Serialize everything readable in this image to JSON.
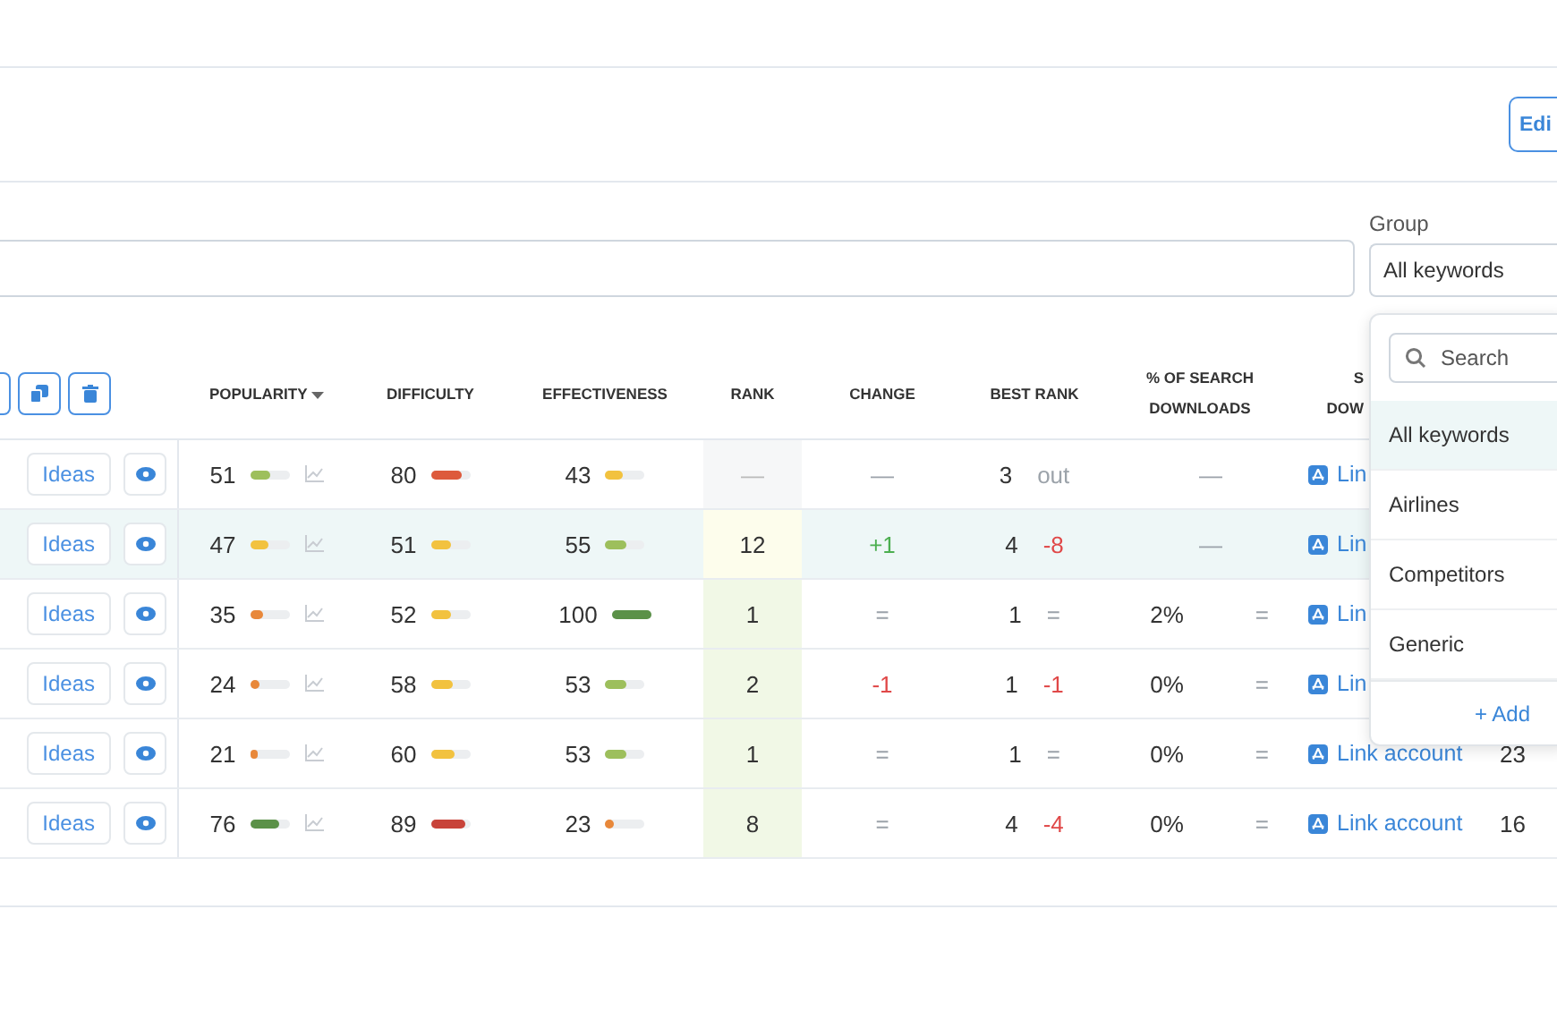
{
  "toolbar": {
    "edit_button": "Edi"
  },
  "filter": {
    "group_label": "Group",
    "group_value": "All keywords"
  },
  "table": {
    "columns": [
      {
        "label": "POPULARITY",
        "sorted": true
      },
      {
        "label": "DIFFICULTY",
        "sorted": false
      },
      {
        "label": "EFFECTIVENESS",
        "sorted": false
      },
      {
        "label": "RANK",
        "sorted": false
      },
      {
        "label": "CHANGE",
        "sorted": false
      },
      {
        "label": "BEST RANK",
        "sorted": false
      },
      {
        "label": "% OF SEARCH DOWNLOADS",
        "sorted": false
      },
      {
        "label": "S DOW",
        "sorted": false
      }
    ],
    "rows": [
      {
        "selected": false,
        "ideas": "Ideas",
        "popularity": {
          "value": "51",
          "level": 0.51,
          "color": "#9dbf5c"
        },
        "difficulty": {
          "value": "80",
          "level": 0.8,
          "color": "#dd5a3c"
        },
        "effectiveness": {
          "value": "43",
          "level": 0.43,
          "color": "#f2c23f"
        },
        "rank": {
          "value": "—",
          "kind": "unranked"
        },
        "change": {
          "value": "—",
          "kind": "none"
        },
        "best_rank": {
          "value": "3",
          "delta": "out",
          "kind": "none"
        },
        "downloads": {
          "value": "—",
          "kind": "none"
        },
        "link": "Lin"
      },
      {
        "selected": true,
        "ideas": "Ideas",
        "popularity": {
          "value": "47",
          "level": 0.47,
          "color": "#f2c23f"
        },
        "difficulty": {
          "value": "51",
          "level": 0.51,
          "color": "#f2c23f"
        },
        "effectiveness": {
          "value": "55",
          "level": 0.55,
          "color": "#9dbf5c"
        },
        "rank": {
          "value": "12",
          "kind": "low"
        },
        "change": {
          "value": "+1",
          "kind": "up"
        },
        "best_rank": {
          "value": "4",
          "delta": "-8",
          "kind": "down"
        },
        "downloads": {
          "value": "—",
          "kind": "none"
        },
        "link": "Lin"
      },
      {
        "selected": false,
        "ideas": "Ideas",
        "popularity": {
          "value": "35",
          "level": 0.35,
          "color": "#e8883a"
        },
        "difficulty": {
          "value": "52",
          "level": 0.52,
          "color": "#f2c23f"
        },
        "effectiveness": {
          "value": "100",
          "level": 1,
          "color": "#5b9148"
        },
        "rank": {
          "value": "1",
          "kind": "top"
        },
        "change": {
          "value": "=",
          "kind": "same"
        },
        "best_rank": {
          "value": "1",
          "delta": "=",
          "kind": "same"
        },
        "downloads": {
          "value": "2%",
          "trend": "=",
          "kind": "value"
        },
        "link": "Lin"
      },
      {
        "selected": false,
        "ideas": "Ideas",
        "popularity": {
          "value": "24",
          "level": 0.24,
          "color": "#e8883a"
        },
        "difficulty": {
          "value": "58",
          "level": 0.58,
          "color": "#f2c23f"
        },
        "effectiveness": {
          "value": "53",
          "level": 0.53,
          "color": "#9dbf5c"
        },
        "rank": {
          "value": "2",
          "kind": "top"
        },
        "change": {
          "value": "-1",
          "kind": "down"
        },
        "best_rank": {
          "value": "1",
          "delta": "-1",
          "kind": "down"
        },
        "downloads": {
          "value": "0%",
          "trend": "=",
          "kind": "value"
        },
        "link": "Lin"
      },
      {
        "selected": false,
        "ideas": "Ideas",
        "popularity": {
          "value": "21",
          "level": 0.21,
          "color": "#e8883a"
        },
        "difficulty": {
          "value": "60",
          "level": 0.6,
          "color": "#f2c23f"
        },
        "effectiveness": {
          "value": "53",
          "level": 0.53,
          "color": "#9dbf5c"
        },
        "rank": {
          "value": "1",
          "kind": "top"
        },
        "change": {
          "value": "=",
          "kind": "same"
        },
        "best_rank": {
          "value": "1",
          "delta": "=",
          "kind": "same"
        },
        "downloads": {
          "value": "0%",
          "trend": "=",
          "kind": "value"
        },
        "link": "Link account",
        "column_10": "23"
      },
      {
        "selected": false,
        "ideas": "Ideas",
        "popularity": {
          "value": "76",
          "level": 0.76,
          "color": "#5b9148"
        },
        "difficulty": {
          "value": "89",
          "level": 0.89,
          "color": "#c8433a"
        },
        "effectiveness": {
          "value": "23",
          "level": 0.23,
          "color": "#e8883a"
        },
        "rank": {
          "value": "8",
          "kind": "top"
        },
        "change": {
          "value": "=",
          "kind": "same"
        },
        "best_rank": {
          "value": "4",
          "delta": "-4",
          "kind": "down"
        },
        "downloads": {
          "value": "0%",
          "trend": "=",
          "kind": "value"
        },
        "link": "Link account",
        "column_10": "16"
      }
    ]
  },
  "group_menu": {
    "search": {
      "placeholder": "Search"
    },
    "items": [
      {
        "label": "All keywords",
        "selected": true
      },
      {
        "label": "Airlines",
        "selected": false
      },
      {
        "label": "Competitors",
        "selected": false
      },
      {
        "label": "Generic",
        "selected": false
      }
    ],
    "add_link": "+ Add"
  }
}
